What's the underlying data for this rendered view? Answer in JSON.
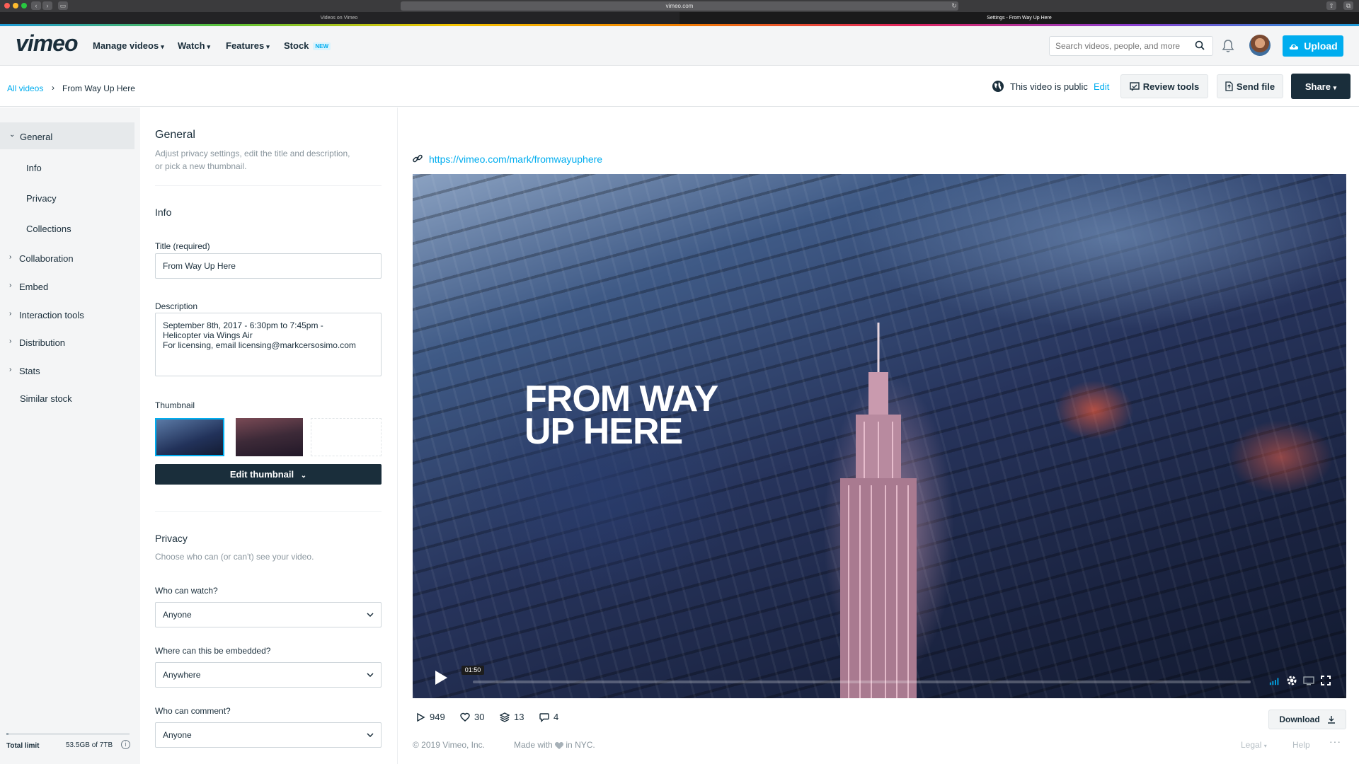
{
  "browser": {
    "address": "vimeo.com",
    "tabs": [
      "Videos on Vimeo",
      "Settings - From Way Up Here"
    ]
  },
  "nav": {
    "logo": "vimeo",
    "items": [
      "Manage videos",
      "Watch",
      "Features",
      "Stock"
    ],
    "stock_badge": "NEW",
    "search_placeholder": "Search videos, people, and more",
    "upload_label": "Upload"
  },
  "subheader": {
    "breadcrumb_root": "All videos",
    "breadcrumb_current": "From Way Up Here",
    "public_text": "This video is public",
    "edit_label": "Edit",
    "review_tools": "Review tools",
    "send_file": "Send file",
    "share": "Share"
  },
  "sidebar": {
    "items": [
      {
        "label": "General",
        "chevron": "down",
        "active": true
      },
      {
        "label": "Info",
        "chevron": "",
        "indent": true
      },
      {
        "label": "Privacy",
        "chevron": "",
        "indent": true
      },
      {
        "label": "Collections",
        "chevron": "",
        "indent": true
      },
      {
        "label": "Collaboration",
        "chevron": "right"
      },
      {
        "label": "Embed",
        "chevron": "right"
      },
      {
        "label": "Interaction tools",
        "chevron": "right"
      },
      {
        "label": "Distribution",
        "chevron": "right"
      },
      {
        "label": "Stats",
        "chevron": "right"
      },
      {
        "label": "Similar stock",
        "chevron": ""
      }
    ],
    "storage_label": "Total limit",
    "storage_value": "53.5GB of 7TB",
    "storage_fraction": 0.0076
  },
  "settings": {
    "general_title": "General",
    "general_desc_1": "Adjust privacy settings, edit the title and description,",
    "general_desc_2": "or pick a new thumbnail.",
    "info_title": "Info",
    "title_label": "Title (required)",
    "title_value": "From Way Up Here",
    "description_label": "Description",
    "description_line_1": "September 8th, 2017 - 6:30pm to 7:45pm -",
    "description_line_2": "Helicopter via Wings Air",
    "description_line_3": "For licensing, email licensing@markcersosimo.com",
    "thumbnail_label": "Thumbnail",
    "edit_thumbnail": "Edit thumbnail",
    "privacy_title": "Privacy",
    "privacy_desc": "Choose who can (or can't) see your video.",
    "who_watch_label": "Who can watch?",
    "who_watch_value": "Anyone",
    "embed_label": "Where can this be embedded?",
    "embed_value": "Anywhere",
    "comment_label": "Who can comment?",
    "comment_value": "Anyone"
  },
  "preview": {
    "url": "https://vimeo.com/mark/fromwayuphere",
    "video_title_line_1": "FROM WAY",
    "video_title_line_2": "UP HERE",
    "timestamp": "01:50",
    "stats": {
      "plays": "949",
      "likes": "30",
      "collections": "13",
      "comments": "4"
    },
    "download_label": "Download"
  },
  "footer": {
    "copyright": "© 2019 Vimeo, Inc.",
    "made_with": "Made with",
    "in_nyc": "in NYC.",
    "legal": "Legal",
    "help": "Help"
  },
  "colors": {
    "accent": "#00adef",
    "dark": "#1a2e3b",
    "muted": "#8a969e"
  }
}
